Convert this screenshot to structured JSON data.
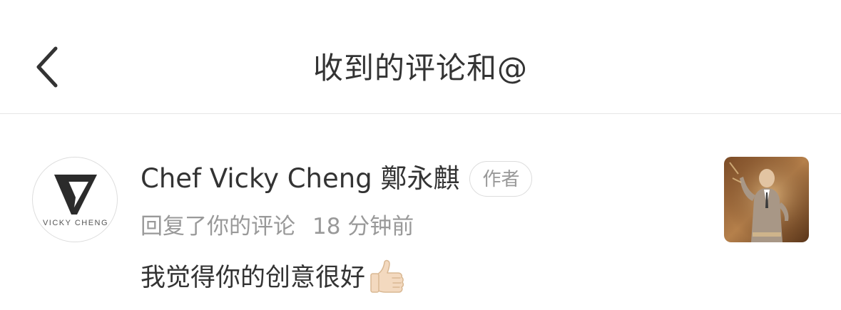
{
  "header": {
    "title": "收到的评论和@",
    "back_icon": "chevron-left-icon"
  },
  "notification": {
    "avatar_text": "VICKY CHENG",
    "user_name": "Chef Vicky Cheng 鄭永麒",
    "badge": "作者",
    "action": "回复了你的评论",
    "time": "18 分钟前",
    "comment": "我觉得你的创意很好",
    "emoji_icon": "thumbs-up-icon",
    "thumbnail_icon": "post-thumbnail-image"
  },
  "colors": {
    "primary_text": "#333333",
    "secondary_text": "#999999",
    "divider": "#e5e5e5",
    "background": "#ffffff"
  }
}
